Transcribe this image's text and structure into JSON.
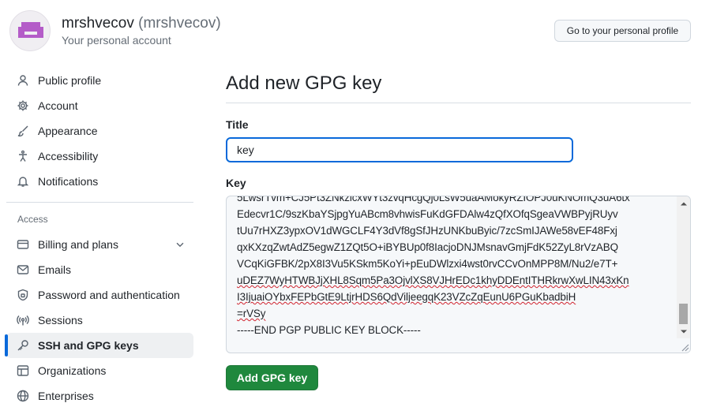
{
  "header": {
    "display_name": "mrshvecov",
    "login": "(mrshvecov)",
    "subtitle": "Your personal account",
    "profile_button": "Go to your personal profile",
    "avatar_icon": "identicon-avatar"
  },
  "sidebar": {
    "items": [
      {
        "label": "Public profile",
        "icon": "person-icon"
      },
      {
        "label": "Account",
        "icon": "gear-icon"
      },
      {
        "label": "Appearance",
        "icon": "paintbrush-icon"
      },
      {
        "label": "Accessibility",
        "icon": "accessibility-icon"
      },
      {
        "label": "Notifications",
        "icon": "bell-icon"
      }
    ],
    "access_label": "Access",
    "access_items": [
      {
        "label": "Billing and plans",
        "icon": "credit-card-icon"
      },
      {
        "label": "Emails",
        "icon": "mail-icon"
      },
      {
        "label": "Password and authentication",
        "icon": "shield-lock-icon"
      },
      {
        "label": "Sessions",
        "icon": "broadcast-icon"
      },
      {
        "label": "SSH and GPG keys",
        "icon": "key-icon",
        "active": true
      },
      {
        "label": "Organizations",
        "icon": "table-icon"
      },
      {
        "label": "Enterprises",
        "icon": "globe-icon"
      }
    ]
  },
  "main": {
    "title": "Add new GPG key",
    "title_field_label": "Title",
    "title_value": "key",
    "key_field_label": "Key",
    "key_lines": [
      "5LwsrTvm+CJ5Pt3ZNkzlcxWYt3zvqHcgQj0LsW5uaAMokyRZIOPJ0uKNOmQ3uA6tx",
      "Edecvr1C/9szKbaYSjpgYuABcm8vhwisFuKdGFDAlw4zQfXOfqSgeaVWBPyjRUyv",
      "tUu7rHXZ3ypxOV1dWGCLF4Y3dVf8gSfJHzUNKbuByic/7zcSmIJAWe58vEF48Fxj",
      "qxKXzqZwtAdZ5egwZ1ZQt5O+iBYBUp0f8IacjoDNJMsnavGmjFdK52ZyL8rVzABQ",
      "VCqKiGFBK/2pX8I3Vu5KSkm5KoYi+pEuDWlzxi4wst0rvCCvOnMPP8M/Nu2/e7T+",
      "uDEZ7WyHTWBJjXHL8Sqm5Pa3OjvlXS8VJHrEDc1khyDDEntITHRkrwXwLIN43xKn",
      "I3IjuaiOYbxFEPbGtE9LtjrHDS6QdViljeegqK23VZcZqEunU6PGuKbadbiH",
      "=rVSy",
      "-----END PGP PUBLIC KEY BLOCK-----"
    ],
    "submit_button": "Add GPG key"
  },
  "colors": {
    "accent": "#0969da",
    "primary_button": "#1f883d",
    "active_nav_bg": "#eef0f2",
    "avatar_fill": "#b45cc8"
  }
}
